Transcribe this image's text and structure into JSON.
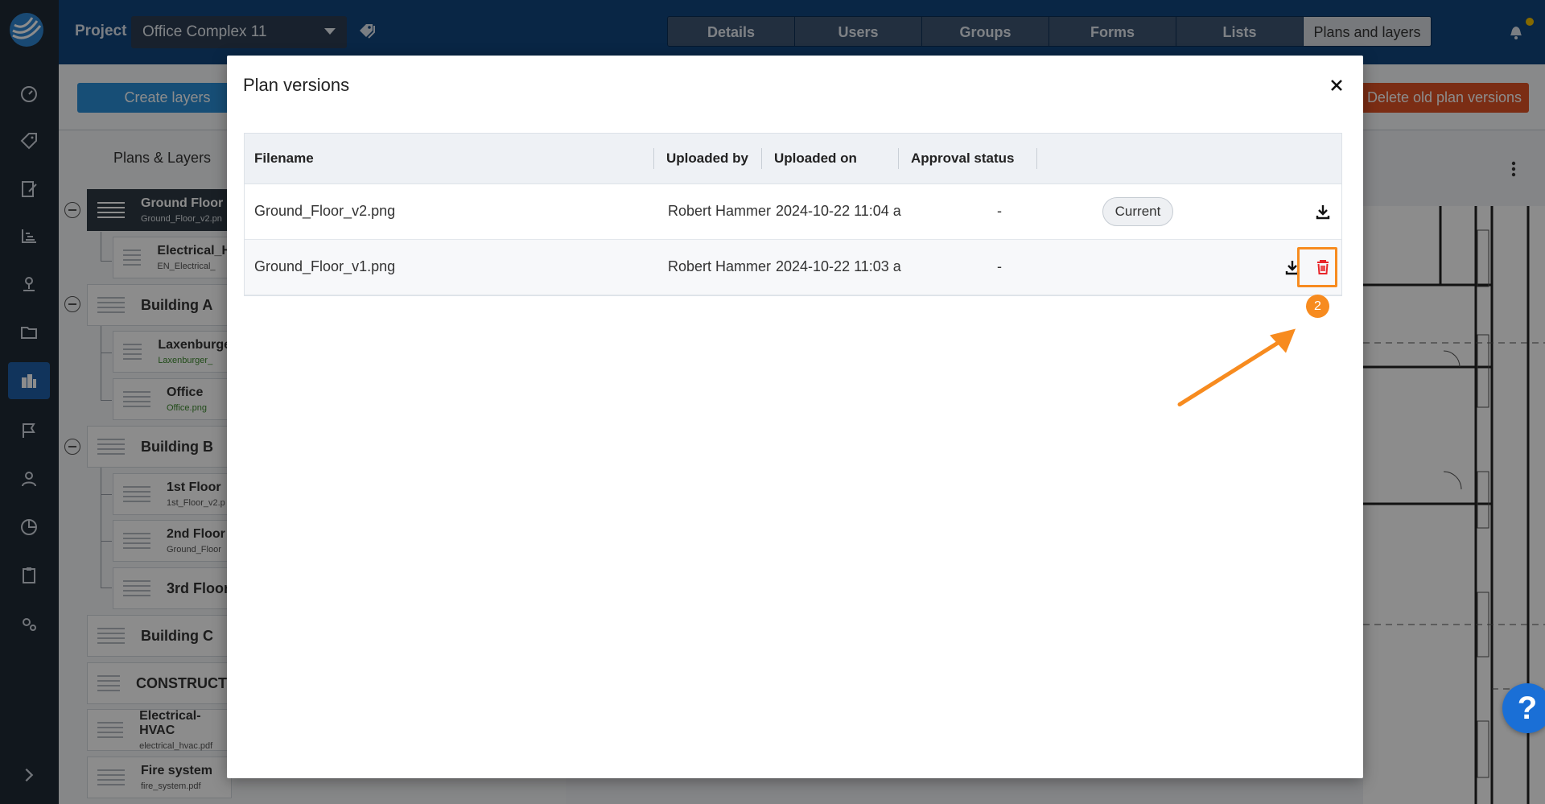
{
  "topbar": {
    "project_label": "Project",
    "project_name": "Office Complex 11",
    "tabs": [
      {
        "label": "Details"
      },
      {
        "label": "Users"
      },
      {
        "label": "Groups"
      },
      {
        "label": "Forms"
      },
      {
        "label": "Lists"
      },
      {
        "label": "Plans and layers"
      }
    ]
  },
  "toolbar": {
    "create_layers_label": "Create layers",
    "delete_old_label": "Delete old plan versions"
  },
  "left_panel": {
    "title": "Plans & Layers",
    "items": [
      {
        "name": "Ground Floor",
        "file": "Ground_Floor_v2.pn"
      },
      {
        "name": "Electrical_H",
        "file": "EN_Electrical_"
      },
      {
        "name": "Building A",
        "file": ""
      },
      {
        "name": "Laxenburge",
        "file": "Laxenburger_"
      },
      {
        "name": "Office",
        "file": "Office.png"
      },
      {
        "name": "Building B",
        "file": ""
      },
      {
        "name": "1st Floor",
        "file": "1st_Floor_v2.p"
      },
      {
        "name": "2nd Floor",
        "file": "Ground_Floor"
      },
      {
        "name": "3rd Floor",
        "file": ""
      },
      {
        "name": "Building C",
        "file": ""
      },
      {
        "name": "CONSTRUCTI",
        "file": ""
      },
      {
        "name": "Electrical-HVAC",
        "file": "electrical_hvac.pdf"
      },
      {
        "name": "Fire system",
        "file": "fire_system.pdf"
      }
    ]
  },
  "modal": {
    "title": "Plan versions",
    "columns": [
      "Filename",
      "Uploaded by",
      "Uploaded on",
      "Approval status"
    ],
    "rows": [
      {
        "filename": "Ground_Floor_v2.png",
        "uploaded_by": "Robert Hammer",
        "uploaded_on": "2024-10-22 11:04 a",
        "approval": "-",
        "badge": "Current"
      },
      {
        "filename": "Ground_Floor_v1.png",
        "uploaded_by": "Robert Hammer",
        "uploaded_on": "2024-10-22 11:03 a",
        "approval": "-",
        "badge": ""
      }
    ]
  },
  "annotation": {
    "step": "2",
    "color": "#f78b1f"
  },
  "help": {
    "label": "?"
  },
  "colors": {
    "primary": "#12457f",
    "accent": "#2a8fd8",
    "danger": "#e05326",
    "delete_icon": "#e8262a"
  }
}
